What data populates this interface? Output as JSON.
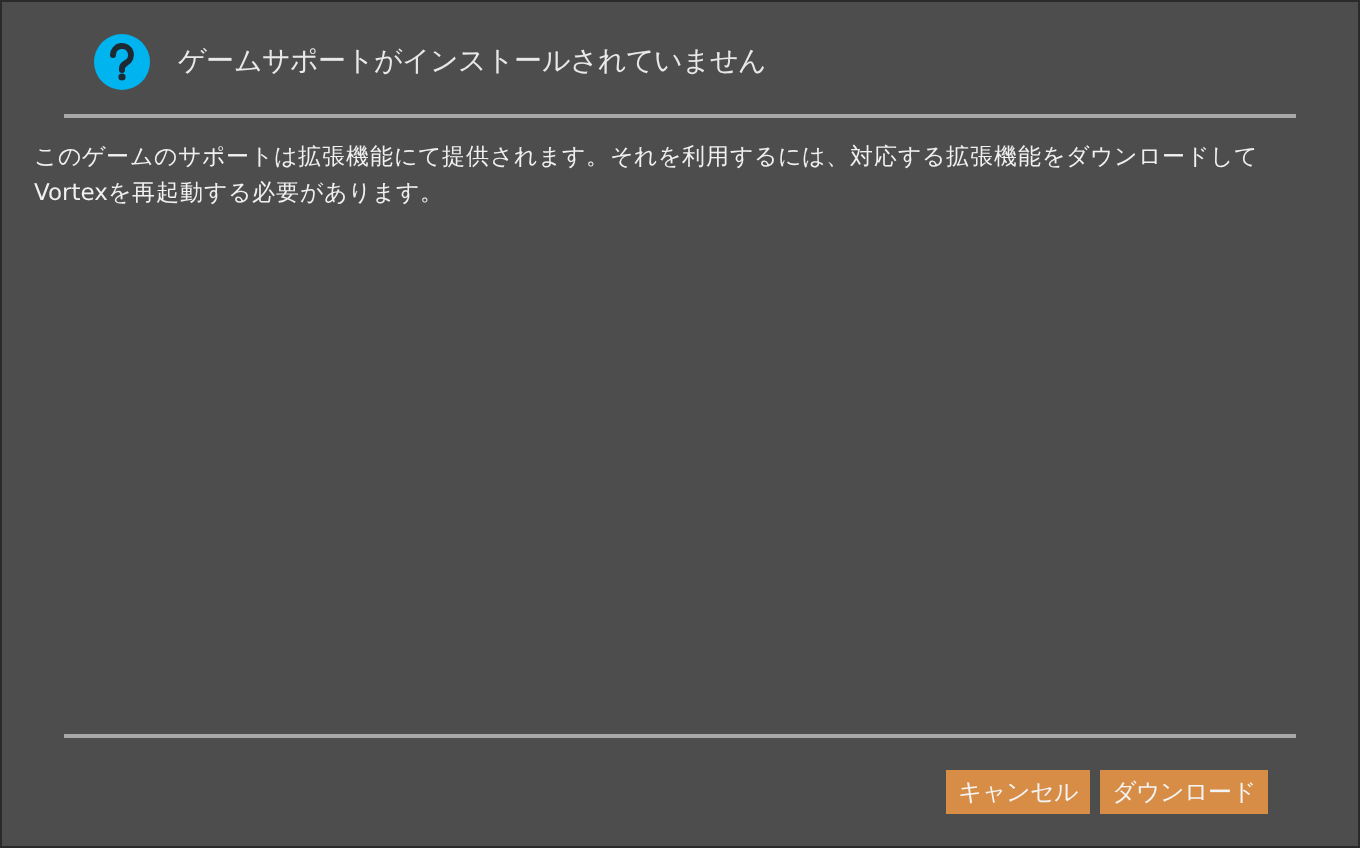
{
  "dialog": {
    "title": "ゲームサポートがインストールされていません",
    "message": "このゲームのサポートは拡張機能にて提供されます。それを利用するには、対応する拡張機能をダウンロードしてVortexを再起動する必要があります。",
    "buttons": [
      {
        "label": "キャンセル"
      },
      {
        "label": "ダウンロード"
      }
    ]
  }
}
